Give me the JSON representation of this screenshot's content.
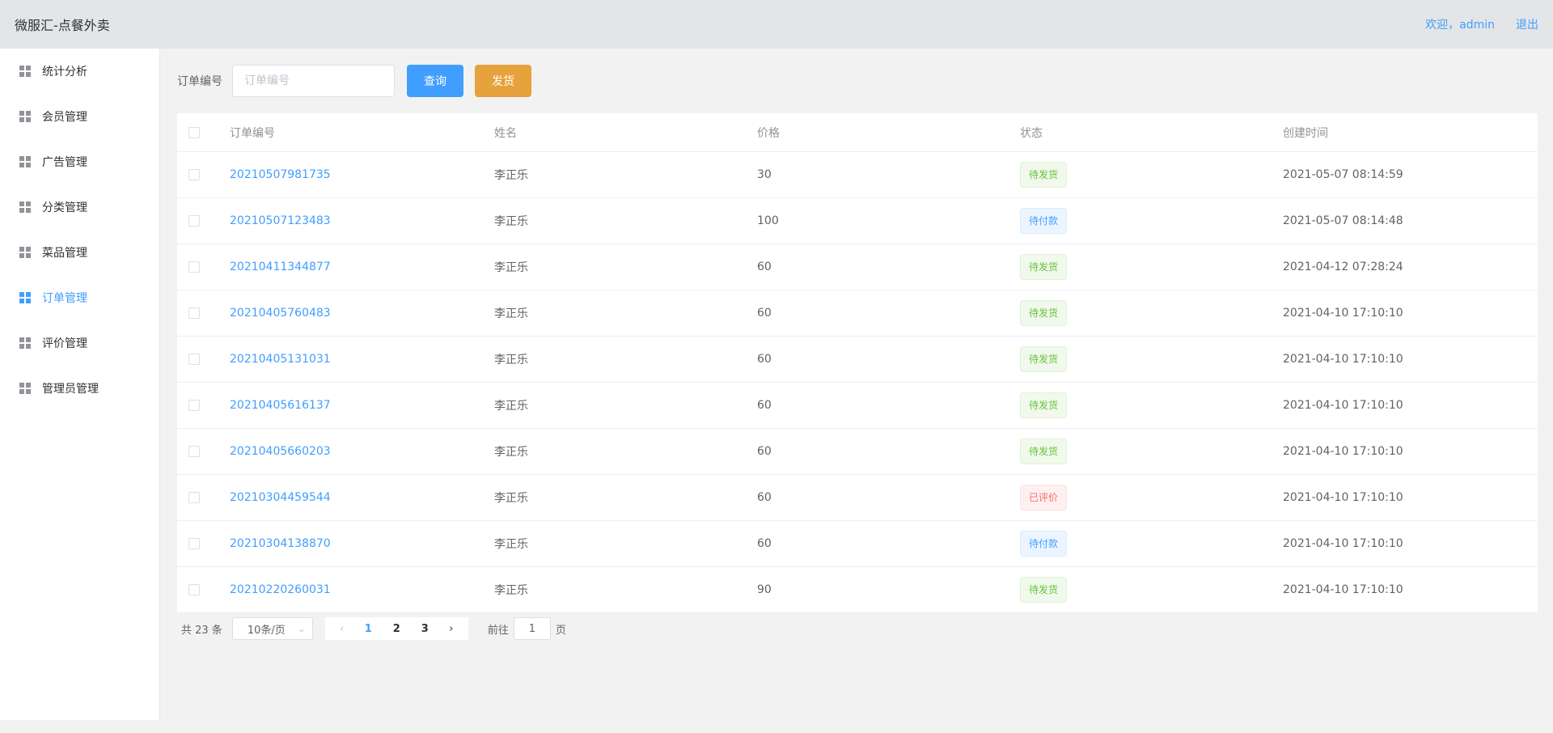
{
  "header": {
    "title": "微服汇-点餐外卖",
    "welcome": "欢迎，admin",
    "logout": "退出"
  },
  "sidebar": {
    "items": [
      {
        "label": "统计分析",
        "active": false
      },
      {
        "label": "会员管理",
        "active": false
      },
      {
        "label": "广告管理",
        "active": false
      },
      {
        "label": "分类管理",
        "active": false
      },
      {
        "label": "菜品管理",
        "active": false
      },
      {
        "label": "订单管理",
        "active": true
      },
      {
        "label": "评价管理",
        "active": false
      },
      {
        "label": "管理员管理",
        "active": false
      }
    ]
  },
  "search": {
    "label": "订单编号",
    "placeholder": "订单编号",
    "value": "",
    "query_label": "查询",
    "ship_label": "发货"
  },
  "table": {
    "headers": [
      "订单编号",
      "姓名",
      "价格",
      "状态",
      "创建时间"
    ],
    "rows": [
      {
        "order_no": "20210507981735",
        "name": "李正乐",
        "price": "30",
        "status": "待发货",
        "status_type": "green",
        "created": "2021-05-07 08:14:59"
      },
      {
        "order_no": "20210507123483",
        "name": "李正乐",
        "price": "100",
        "status": "待付款",
        "status_type": "blue",
        "created": "2021-05-07 08:14:48"
      },
      {
        "order_no": "20210411344877",
        "name": "李正乐",
        "price": "60",
        "status": "待发货",
        "status_type": "green",
        "created": "2021-04-12 07:28:24"
      },
      {
        "order_no": "20210405760483",
        "name": "李正乐",
        "price": "60",
        "status": "待发货",
        "status_type": "green",
        "created": "2021-04-10 17:10:10"
      },
      {
        "order_no": "20210405131031",
        "name": "李正乐",
        "price": "60",
        "status": "待发货",
        "status_type": "green",
        "created": "2021-04-10 17:10:10"
      },
      {
        "order_no": "20210405616137",
        "name": "李正乐",
        "price": "60",
        "status": "待发货",
        "status_type": "green",
        "created": "2021-04-10 17:10:10"
      },
      {
        "order_no": "20210405660203",
        "name": "李正乐",
        "price": "60",
        "status": "待发货",
        "status_type": "green",
        "created": "2021-04-10 17:10:10"
      },
      {
        "order_no": "20210304459544",
        "name": "李正乐",
        "price": "60",
        "status": "已评价",
        "status_type": "red",
        "created": "2021-04-10 17:10:10"
      },
      {
        "order_no": "20210304138870",
        "name": "李正乐",
        "price": "60",
        "status": "待付款",
        "status_type": "blue",
        "created": "2021-04-10 17:10:10"
      },
      {
        "order_no": "20210220260031",
        "name": "李正乐",
        "price": "90",
        "status": "待发货",
        "status_type": "green",
        "created": "2021-04-10 17:10:10"
      }
    ]
  },
  "pagination": {
    "total": "共 23 条",
    "page_size": "10条/页",
    "pages": [
      "1",
      "2",
      "3"
    ],
    "current": "1",
    "goto_label": "前往",
    "goto_value": "1",
    "page_suffix": "页"
  },
  "colors": {
    "primary": "#409eff",
    "warning": "#e6a23c",
    "success": "#67c23a",
    "danger": "#f56c6c"
  }
}
